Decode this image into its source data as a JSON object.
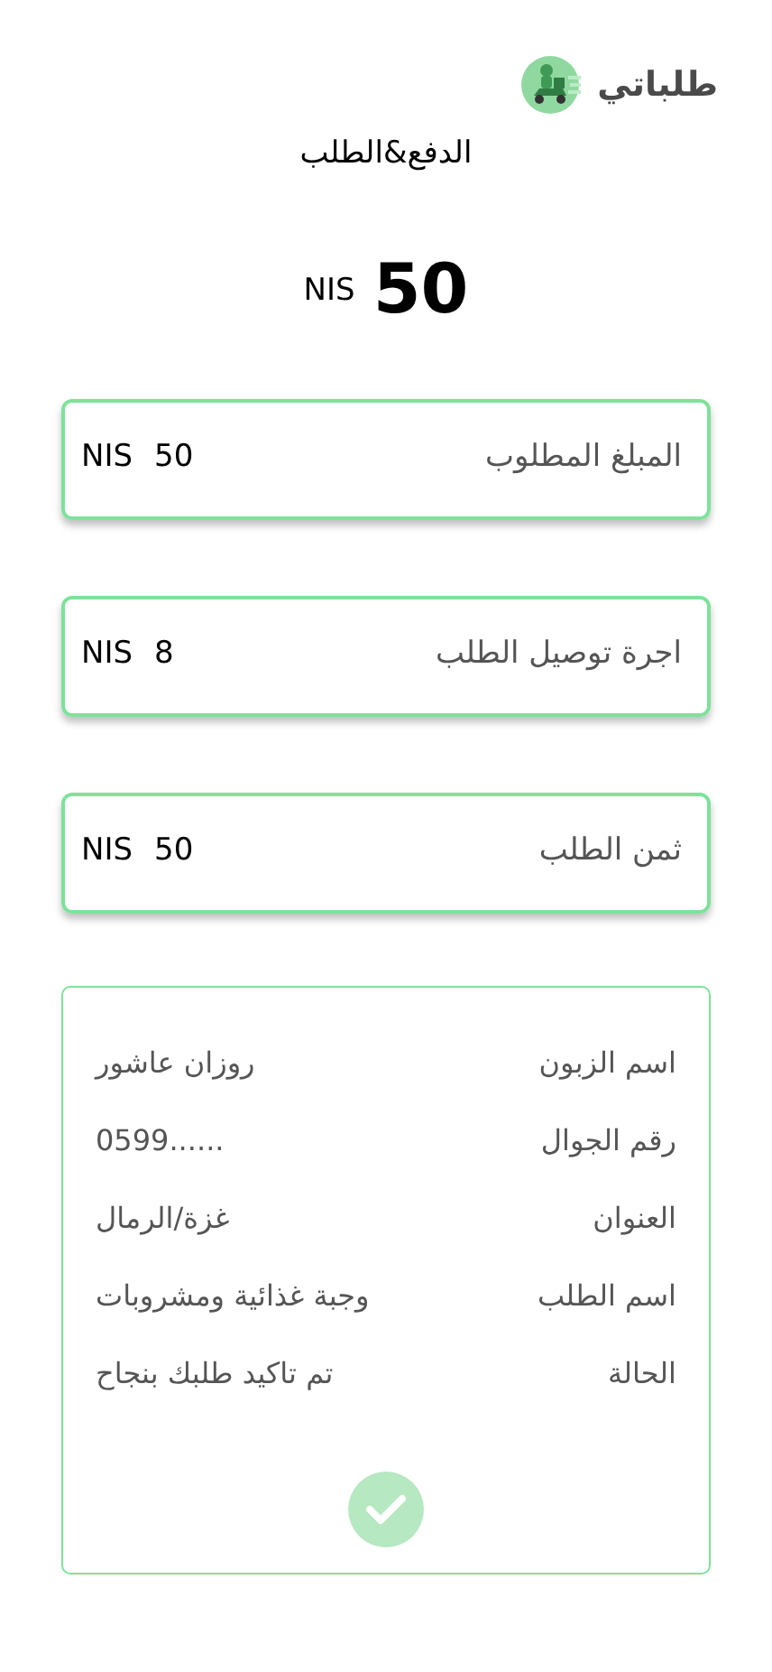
{
  "header": {
    "brand": "طلباتي"
  },
  "title": "الدفع&الطلب",
  "total": {
    "currency": "NIS",
    "amount": "50"
  },
  "price_cards": [
    {
      "label": "المبلغ المطلوب",
      "currency": "NIS",
      "amount": "50"
    },
    {
      "label": "اجرة توصيل الطلب",
      "currency": "NIS",
      "amount": "8"
    },
    {
      "label": "ثمن الطلب",
      "currency": "NIS",
      "amount": "50"
    }
  ],
  "details": [
    {
      "label": "اسم الزبون",
      "value": "روزان عاشور"
    },
    {
      "label": "رقم الجوال",
      "value": "0599......"
    },
    {
      "label": "العنوان",
      "value": "غزة/الرمال"
    },
    {
      "label": "اسم الطلب",
      "value": "وجبة غذائية ومشروبات"
    },
    {
      "label": "الحالة",
      "value": "تم تاكيد طلبك بنجاح"
    }
  ],
  "confirmed": true
}
